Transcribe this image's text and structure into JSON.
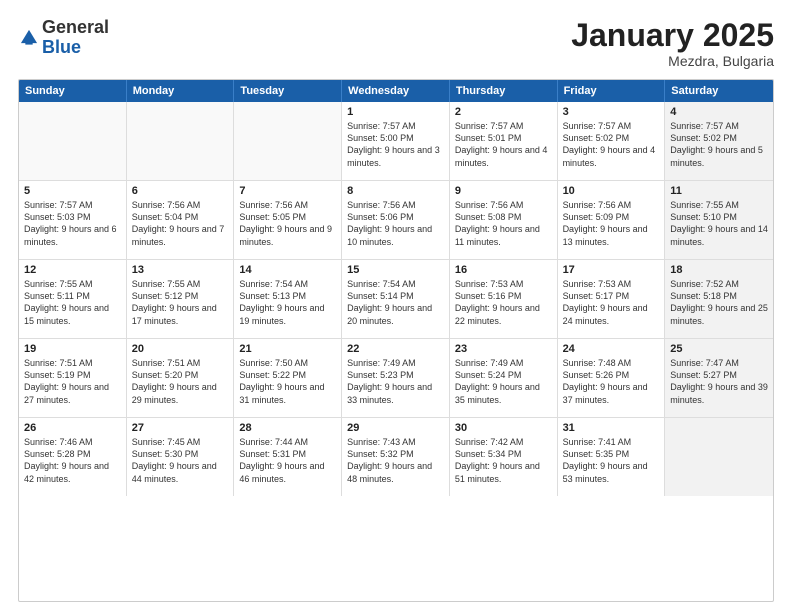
{
  "logo": {
    "general": "General",
    "blue": "Blue"
  },
  "header": {
    "title": "January 2025",
    "location": "Mezdra, Bulgaria"
  },
  "weekdays": [
    "Sunday",
    "Monday",
    "Tuesday",
    "Wednesday",
    "Thursday",
    "Friday",
    "Saturday"
  ],
  "weeks": [
    [
      {
        "day": "",
        "text": "",
        "empty": true
      },
      {
        "day": "",
        "text": "",
        "empty": true
      },
      {
        "day": "",
        "text": "",
        "empty": true
      },
      {
        "day": "1",
        "text": "Sunrise: 7:57 AM\nSunset: 5:00 PM\nDaylight: 9 hours and 3 minutes."
      },
      {
        "day": "2",
        "text": "Sunrise: 7:57 AM\nSunset: 5:01 PM\nDaylight: 9 hours and 4 minutes."
      },
      {
        "day": "3",
        "text": "Sunrise: 7:57 AM\nSunset: 5:02 PM\nDaylight: 9 hours and 4 minutes."
      },
      {
        "day": "4",
        "text": "Sunrise: 7:57 AM\nSunset: 5:02 PM\nDaylight: 9 hours and 5 minutes.",
        "shaded": true
      }
    ],
    [
      {
        "day": "5",
        "text": "Sunrise: 7:57 AM\nSunset: 5:03 PM\nDaylight: 9 hours and 6 minutes."
      },
      {
        "day": "6",
        "text": "Sunrise: 7:56 AM\nSunset: 5:04 PM\nDaylight: 9 hours and 7 minutes."
      },
      {
        "day": "7",
        "text": "Sunrise: 7:56 AM\nSunset: 5:05 PM\nDaylight: 9 hours and 9 minutes."
      },
      {
        "day": "8",
        "text": "Sunrise: 7:56 AM\nSunset: 5:06 PM\nDaylight: 9 hours and 10 minutes."
      },
      {
        "day": "9",
        "text": "Sunrise: 7:56 AM\nSunset: 5:08 PM\nDaylight: 9 hours and 11 minutes."
      },
      {
        "day": "10",
        "text": "Sunrise: 7:56 AM\nSunset: 5:09 PM\nDaylight: 9 hours and 13 minutes."
      },
      {
        "day": "11",
        "text": "Sunrise: 7:55 AM\nSunset: 5:10 PM\nDaylight: 9 hours and 14 minutes.",
        "shaded": true
      }
    ],
    [
      {
        "day": "12",
        "text": "Sunrise: 7:55 AM\nSunset: 5:11 PM\nDaylight: 9 hours and 15 minutes."
      },
      {
        "day": "13",
        "text": "Sunrise: 7:55 AM\nSunset: 5:12 PM\nDaylight: 9 hours and 17 minutes."
      },
      {
        "day": "14",
        "text": "Sunrise: 7:54 AM\nSunset: 5:13 PM\nDaylight: 9 hours and 19 minutes."
      },
      {
        "day": "15",
        "text": "Sunrise: 7:54 AM\nSunset: 5:14 PM\nDaylight: 9 hours and 20 minutes."
      },
      {
        "day": "16",
        "text": "Sunrise: 7:53 AM\nSunset: 5:16 PM\nDaylight: 9 hours and 22 minutes."
      },
      {
        "day": "17",
        "text": "Sunrise: 7:53 AM\nSunset: 5:17 PM\nDaylight: 9 hours and 24 minutes."
      },
      {
        "day": "18",
        "text": "Sunrise: 7:52 AM\nSunset: 5:18 PM\nDaylight: 9 hours and 25 minutes.",
        "shaded": true
      }
    ],
    [
      {
        "day": "19",
        "text": "Sunrise: 7:51 AM\nSunset: 5:19 PM\nDaylight: 9 hours and 27 minutes."
      },
      {
        "day": "20",
        "text": "Sunrise: 7:51 AM\nSunset: 5:20 PM\nDaylight: 9 hours and 29 minutes."
      },
      {
        "day": "21",
        "text": "Sunrise: 7:50 AM\nSunset: 5:22 PM\nDaylight: 9 hours and 31 minutes."
      },
      {
        "day": "22",
        "text": "Sunrise: 7:49 AM\nSunset: 5:23 PM\nDaylight: 9 hours and 33 minutes."
      },
      {
        "day": "23",
        "text": "Sunrise: 7:49 AM\nSunset: 5:24 PM\nDaylight: 9 hours and 35 minutes."
      },
      {
        "day": "24",
        "text": "Sunrise: 7:48 AM\nSunset: 5:26 PM\nDaylight: 9 hours and 37 minutes."
      },
      {
        "day": "25",
        "text": "Sunrise: 7:47 AM\nSunset: 5:27 PM\nDaylight: 9 hours and 39 minutes.",
        "shaded": true
      }
    ],
    [
      {
        "day": "26",
        "text": "Sunrise: 7:46 AM\nSunset: 5:28 PM\nDaylight: 9 hours and 42 minutes."
      },
      {
        "day": "27",
        "text": "Sunrise: 7:45 AM\nSunset: 5:30 PM\nDaylight: 9 hours and 44 minutes."
      },
      {
        "day": "28",
        "text": "Sunrise: 7:44 AM\nSunset: 5:31 PM\nDaylight: 9 hours and 46 minutes."
      },
      {
        "day": "29",
        "text": "Sunrise: 7:43 AM\nSunset: 5:32 PM\nDaylight: 9 hours and 48 minutes."
      },
      {
        "day": "30",
        "text": "Sunrise: 7:42 AM\nSunset: 5:34 PM\nDaylight: 9 hours and 51 minutes."
      },
      {
        "day": "31",
        "text": "Sunrise: 7:41 AM\nSunset: 5:35 PM\nDaylight: 9 hours and 53 minutes."
      },
      {
        "day": "",
        "text": "",
        "empty": true,
        "shaded": true
      }
    ]
  ]
}
